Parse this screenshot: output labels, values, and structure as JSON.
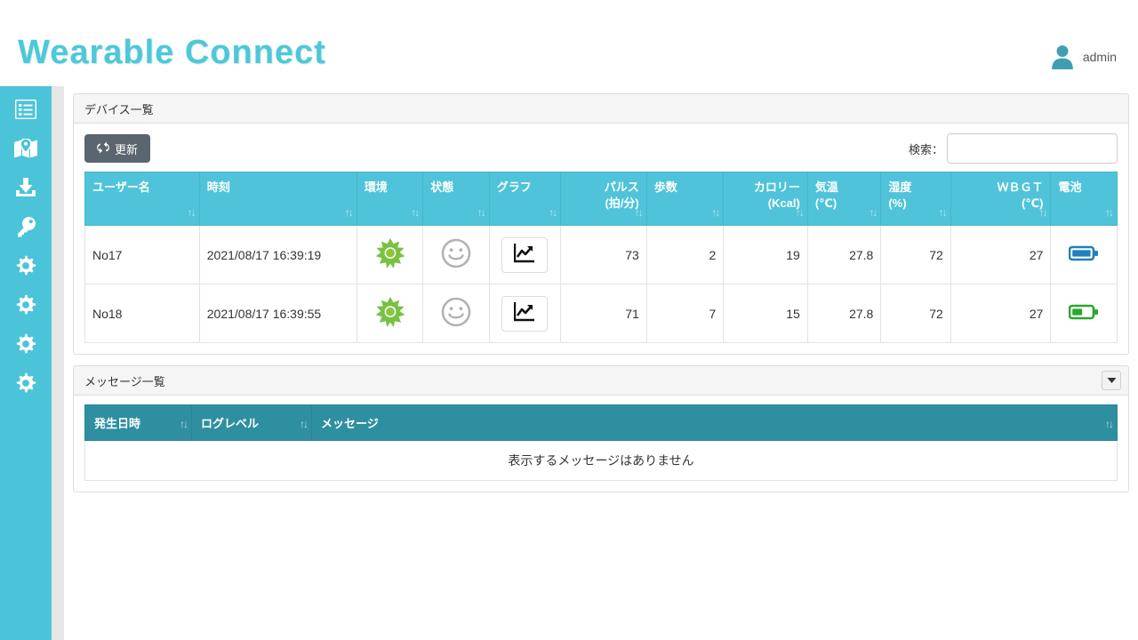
{
  "header": {
    "brand": "Wearable Connect",
    "user_name": "admin",
    "user_icon": "user-icon"
  },
  "sidebar": {
    "items": [
      {
        "icon": "list-icon",
        "name": "sidebar-item-device-list"
      },
      {
        "icon": "map-marker-icon",
        "name": "sidebar-item-map"
      },
      {
        "icon": "download-icon",
        "name": "sidebar-item-download"
      },
      {
        "icon": "key-icon",
        "name": "sidebar-item-key"
      },
      {
        "icon": "gear-icon",
        "name": "sidebar-item-settings-1"
      },
      {
        "icon": "gear-icon",
        "name": "sidebar-item-settings-2"
      },
      {
        "icon": "gear-icon",
        "name": "sidebar-item-settings-3"
      },
      {
        "icon": "gear-icon",
        "name": "sidebar-item-settings-4"
      }
    ]
  },
  "device_panel": {
    "title": "デバイス一覧",
    "refresh_label": "更新",
    "refresh_icon": "refresh-icon",
    "search_label": "検索：",
    "search_value": "",
    "search_placeholder": "",
    "columns": [
      {
        "label": "ユーザー名",
        "sub": "",
        "align": "left",
        "sort": "↑↓"
      },
      {
        "label": "時刻",
        "sub": "",
        "align": "left",
        "sort": "↑↓"
      },
      {
        "label": "環境",
        "sub": "",
        "align": "left",
        "sort": "↑↓"
      },
      {
        "label": "状態",
        "sub": "",
        "align": "left",
        "sort": "↑↓"
      },
      {
        "label": "グラフ",
        "sub": "",
        "align": "left",
        "sort": "↑↓"
      },
      {
        "label": "パルス",
        "sub": "(拍/分)",
        "align": "right",
        "sort": "↑↓"
      },
      {
        "label": "歩数",
        "sub": "",
        "align": "left",
        "sort": "↑↓"
      },
      {
        "label": "カロリー",
        "sub": "(Kcal)",
        "align": "right",
        "sort": "↑↓"
      },
      {
        "label": "気温",
        "sub": "(℃)",
        "align": "left",
        "sort": "↑↓"
      },
      {
        "label": "湿度",
        "sub": "(%)",
        "align": "left",
        "sort": "↑↓"
      },
      {
        "label": "ＷＢＧＴ",
        "sub": "(℃)",
        "align": "right",
        "sort": "↑↓"
      },
      {
        "label": "電池",
        "sub": "",
        "align": "left",
        "sort": "↑↓"
      }
    ],
    "rows": [
      {
        "user": "No17",
        "time": "2021/08/17 16:39:19",
        "environment_icon": "sun-icon",
        "status_icon": "smiley-icon",
        "graph_icon": "line-chart-icon",
        "pulse": "73",
        "steps": "2",
        "calories": "19",
        "temperature": "27.8",
        "humidity": "72",
        "wbgt": "27",
        "battery_icon": "battery-full-icon",
        "battery_level": 100,
        "battery_color": "#1f7fc0"
      },
      {
        "user": "No18",
        "time": "2021/08/17 16:39:55",
        "environment_icon": "sun-icon",
        "status_icon": "smiley-icon",
        "graph_icon": "line-chart-icon",
        "pulse": "71",
        "steps": "7",
        "calories": "15",
        "temperature": "27.8",
        "humidity": "72",
        "wbgt": "27",
        "battery_icon": "battery-half-icon",
        "battery_level": 55,
        "battery_color": "#2aa82a"
      }
    ]
  },
  "message_panel": {
    "title": "メッセージ一覧",
    "collapse_icon": "chevron-down-icon",
    "columns": [
      {
        "label": "発生日時",
        "sort": "↑↓"
      },
      {
        "label": "ログレベル",
        "sort": "↑↓"
      },
      {
        "label": "メッセージ",
        "sort": "↑↓"
      }
    ],
    "empty_text": "表示するメッセージはありません"
  },
  "colors": {
    "brand": "#4ec8d8",
    "sidebar": "#4bc3d8",
    "device_header": "#4fc3da",
    "message_header": "#2e8fa0",
    "refresh_button": "#5a6570",
    "sun_green": "#7ac143",
    "smiley_gray": "#b0b0b0"
  }
}
